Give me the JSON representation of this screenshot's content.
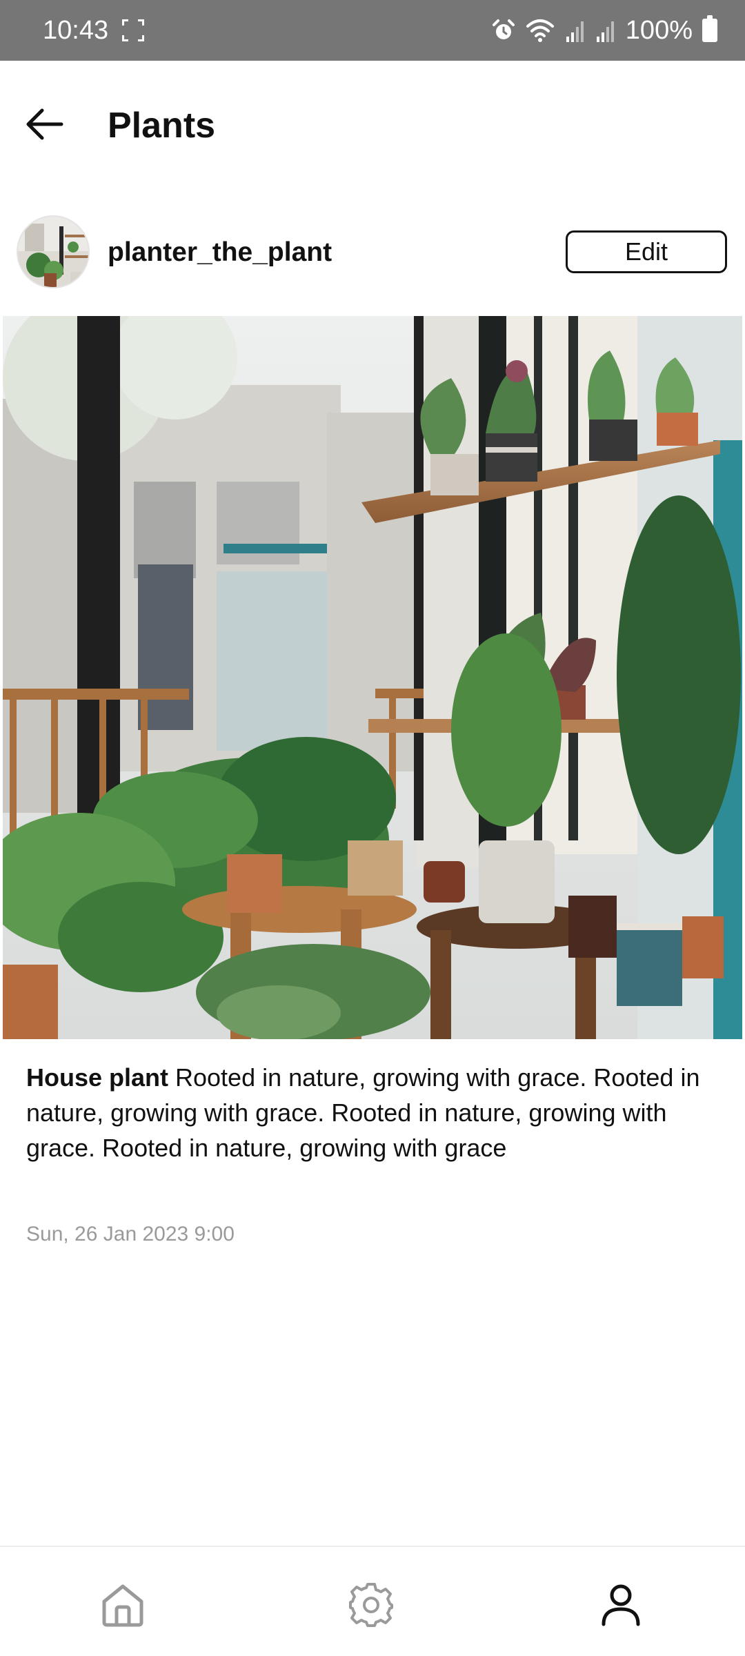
{
  "status_bar": {
    "time": "10:43",
    "battery": "100%",
    "icons": [
      "screenshot-icon",
      "alarm-icon",
      "wifi-icon",
      "signal-icon",
      "signal-icon",
      "battery-icon"
    ]
  },
  "header": {
    "title": "Plants",
    "back_icon": "arrow-left-icon"
  },
  "post": {
    "username": "planter_the_plant",
    "edit_label": "Edit",
    "caption_title": "House plant",
    "caption_text": " Rooted in nature, growing with grace. Rooted in nature, growing with grace. Rooted in nature, growing with grace. Rooted in nature, growing with grace",
    "timestamp": "Sun, 26 Jan 2023 9:00"
  },
  "bottom_nav": {
    "items": [
      {
        "icon": "home-icon",
        "active": false
      },
      {
        "icon": "gear-icon",
        "active": false
      },
      {
        "icon": "user-icon",
        "active": true
      }
    ]
  },
  "colors": {
    "status_bar": "#767676",
    "text": "#111111",
    "muted_text": "#9a9a9a",
    "inactive_icon": "#9a9a9a"
  }
}
